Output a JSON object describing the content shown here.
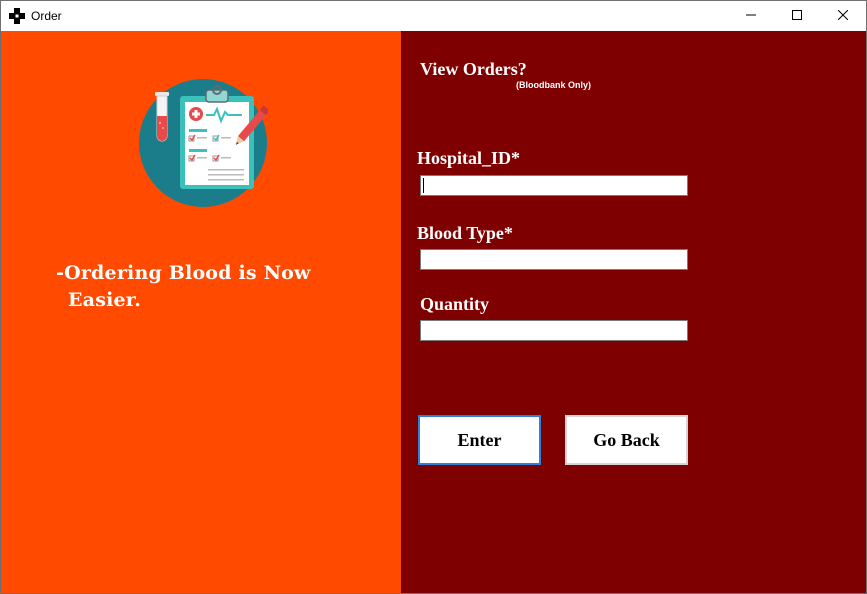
{
  "window": {
    "title": "Order",
    "icon": "cross-icon",
    "controls": [
      "minimize-icon",
      "maximize-icon",
      "close-icon"
    ]
  },
  "left": {
    "illustration": "clipboard-medical-icon",
    "tagline_line1": "-Ordering Blood is Now",
    "tagline_line2": "Easier."
  },
  "form": {
    "view_orders": "View Orders?",
    "bloodbank_only": "(Bloodbank Only)",
    "hospital_id_label": "Hospital_ID*",
    "hospital_id_value": "",
    "blood_type_label": "Blood Type*",
    "blood_type_value": "",
    "quantity_label": "Quantity",
    "quantity_value": "",
    "enter_label": "Enter",
    "go_back_label": "Go Back"
  },
  "colors": {
    "left_panel": "#ff4a00",
    "right_panel": "#7f0000",
    "focus_border": "#2f7fd6"
  }
}
